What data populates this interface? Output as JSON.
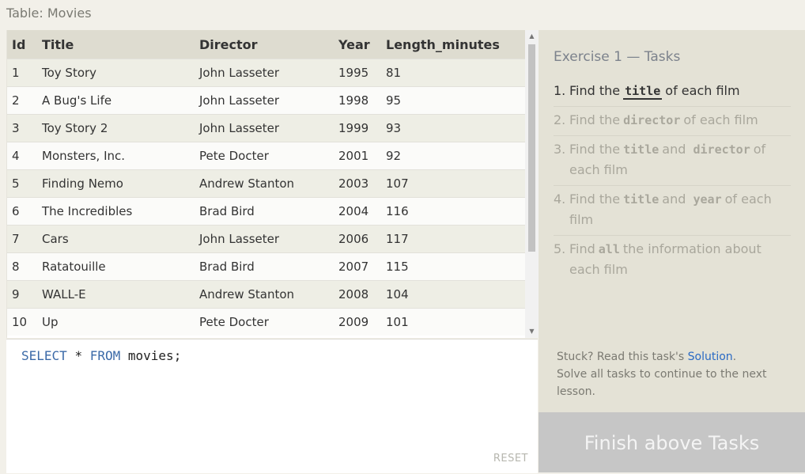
{
  "table_label": "Table: Movies",
  "columns": [
    "Id",
    "Title",
    "Director",
    "Year",
    "Length_minutes"
  ],
  "rows": [
    [
      "1",
      "Toy Story",
      "John Lasseter",
      "1995",
      "81"
    ],
    [
      "2",
      "A Bug's Life",
      "John Lasseter",
      "1998",
      "95"
    ],
    [
      "3",
      "Toy Story 2",
      "John Lasseter",
      "1999",
      "93"
    ],
    [
      "4",
      "Monsters, Inc.",
      "Pete Docter",
      "2001",
      "92"
    ],
    [
      "5",
      "Finding Nemo",
      "Andrew Stanton",
      "2003",
      "107"
    ],
    [
      "6",
      "The Incredibles",
      "Brad Bird",
      "2004",
      "116"
    ],
    [
      "7",
      "Cars",
      "John Lasseter",
      "2006",
      "117"
    ],
    [
      "8",
      "Ratatouille",
      "Brad Bird",
      "2007",
      "115"
    ],
    [
      "9",
      "WALL-E",
      "Andrew Stanton",
      "2008",
      "104"
    ],
    [
      "10",
      "Up",
      "Pete Docter",
      "2009",
      "101"
    ]
  ],
  "editor": {
    "kw1": "SELECT",
    "star": "*",
    "kw2": "FROM",
    "rest": "movies;",
    "reset_label": "RESET"
  },
  "exercise_title": "Exercise 1 — Tasks",
  "tasks": [
    {
      "num": "1.",
      "pre": "Find the",
      "code1": "title",
      "mid": "of each film",
      "code2": "",
      "post": "",
      "active": true
    },
    {
      "num": "2.",
      "pre": "Find the",
      "code1": "director",
      "mid": "of each film",
      "code2": "",
      "post": "",
      "active": false
    },
    {
      "num": "3.",
      "pre": "Find the",
      "code1": "title",
      "mid": "and",
      "code2": "director",
      "post": "of each film",
      "active": false
    },
    {
      "num": "4.",
      "pre": "Find the",
      "code1": "title",
      "mid": "and",
      "code2": "year",
      "post": "of each film",
      "active": false
    },
    {
      "num": "5.",
      "pre": "Find",
      "code1": "all",
      "mid": "the information about each film",
      "code2": "",
      "post": "",
      "active": false
    }
  ],
  "stuck": {
    "prefix": "Stuck? Read this task's ",
    "link": "Solution",
    "suffix": ".",
    "line2": "Solve all tasks to continue to the next lesson."
  },
  "finish_label": "Finish above Tasks",
  "colors": {
    "page_bg": "#f2f0e9",
    "panel_bg": "#e4e2d6",
    "header_bg": "#dedcd0",
    "sql_keyword": "#3b6aa8",
    "link": "#2a6ac4",
    "finish_bg": "#c6c6c6"
  },
  "icons": {
    "scroll_up": "triangle-up-icon",
    "scroll_down": "triangle-down-icon"
  }
}
